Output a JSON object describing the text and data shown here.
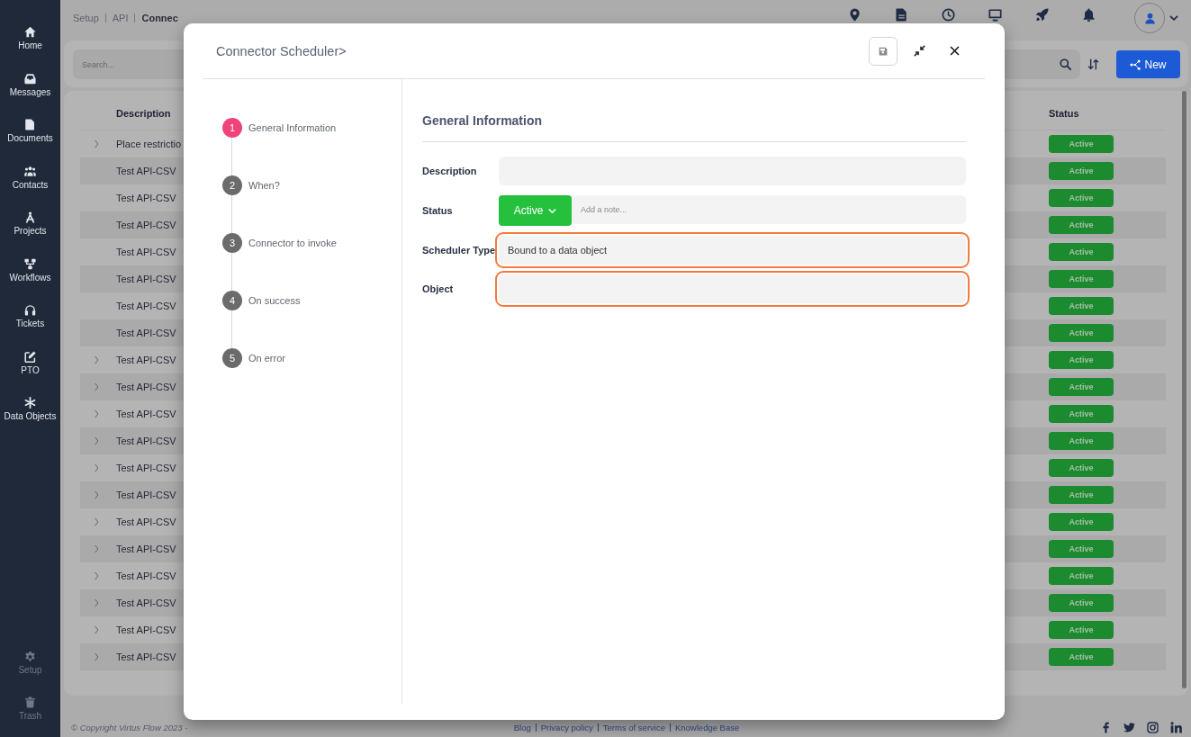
{
  "sidebar": {
    "items": [
      {
        "label": "Home"
      },
      {
        "label": "Messages"
      },
      {
        "label": "Documents"
      },
      {
        "label": "Contacts"
      },
      {
        "label": "Projects"
      },
      {
        "label": "Workflows"
      },
      {
        "label": "Tickets"
      },
      {
        "label": "PTO"
      },
      {
        "label": "Data Objects"
      }
    ],
    "bottom_items": [
      {
        "label": "Setup"
      },
      {
        "label": "Trash"
      }
    ]
  },
  "topbar": {
    "breadcrumb": [
      {
        "label": "Setup",
        "current": false
      },
      {
        "label": "API",
        "current": false
      },
      {
        "label": "Connec",
        "current": true
      }
    ]
  },
  "search": {
    "placeholder": "Search..."
  },
  "new_button": {
    "label": "New"
  },
  "table": {
    "columns": [
      "Description",
      "Status"
    ],
    "rows": [
      {
        "description": "Place restrictio",
        "expandable": true,
        "status": "Active"
      },
      {
        "description": "Test API-CSV",
        "expandable": false,
        "status": "Active"
      },
      {
        "description": "Test API-CSV",
        "expandable": false,
        "status": "Active"
      },
      {
        "description": "Test API-CSV",
        "expandable": false,
        "status": "Active"
      },
      {
        "description": "Test API-CSV",
        "expandable": false,
        "status": "Active"
      },
      {
        "description": "Test API-CSV",
        "expandable": false,
        "status": "Active"
      },
      {
        "description": "Test API-CSV",
        "expandable": false,
        "status": "Active"
      },
      {
        "description": "Test API-CSV",
        "expandable": false,
        "status": "Active"
      },
      {
        "description": "Test API-CSV",
        "expandable": true,
        "status": "Active"
      },
      {
        "description": "Test API-CSV",
        "expandable": true,
        "status": "Active"
      },
      {
        "description": "Test API-CSV",
        "expandable": true,
        "status": "Active"
      },
      {
        "description": "Test API-CSV",
        "expandable": true,
        "status": "Active"
      },
      {
        "description": "Test API-CSV",
        "expandable": true,
        "status": "Active"
      },
      {
        "description": "Test API-CSV",
        "expandable": true,
        "status": "Active"
      },
      {
        "description": "Test API-CSV",
        "expandable": true,
        "status": "Active"
      },
      {
        "description": "Test API-CSV",
        "expandable": true,
        "status": "Active"
      },
      {
        "description": "Test API-CSV",
        "expandable": true,
        "status": "Active"
      },
      {
        "description": "Test API-CSV",
        "expandable": true,
        "status": "Active"
      },
      {
        "description": "Test API-CSV",
        "expandable": true,
        "status": "Active"
      },
      {
        "description": "Test API-CSV",
        "expandable": true,
        "status": "Active"
      }
    ]
  },
  "footer": {
    "copyright": "© Copyright Virtus Flow 2023 -",
    "links": [
      "Blog",
      "Privacy policy",
      "Terms of service",
      "Knowledge Base"
    ]
  },
  "modal": {
    "title": "Connector Scheduler>",
    "steps": [
      {
        "number": "1",
        "label": "General Information",
        "selected": true
      },
      {
        "number": "2",
        "label": "When?",
        "selected": false
      },
      {
        "number": "3",
        "label": "Connector to invoke",
        "selected": false
      },
      {
        "number": "4",
        "label": "On success",
        "selected": false
      },
      {
        "number": "5",
        "label": "On error",
        "selected": false
      }
    ],
    "section_title": "General Information",
    "fields": [
      {
        "kind": "text",
        "label": "Description",
        "highlighted": false
      },
      {
        "kind": "status",
        "label": "Status",
        "status": "Active",
        "placeholder": "Add a note..."
      },
      {
        "kind": "text",
        "label": "Scheduler Type",
        "value": "Bound to a data object",
        "highlighted": true
      },
      {
        "kind": "text",
        "label": "Object",
        "highlighted": true
      }
    ]
  }
}
